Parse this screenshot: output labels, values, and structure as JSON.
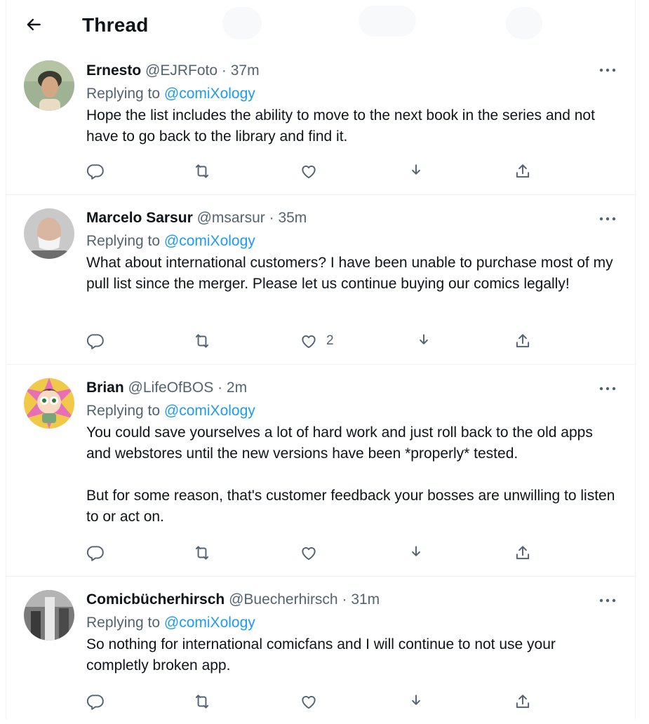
{
  "header": {
    "title": "Thread"
  },
  "tweets": [
    {
      "name": "Ernesto",
      "handle": "@EJRFoto",
      "sep": "·",
      "time": "37m",
      "replying_prefix": "Replying to",
      "replying_to": "@comiXology",
      "text": "Hope the list includes the ability to move to the next book in the series and not have to go back to the library and find it.",
      "like_count": ""
    },
    {
      "name": "Marcelo Sarsur",
      "handle": "@msarsur",
      "sep": "·",
      "time": "35m",
      "replying_prefix": "Replying to",
      "replying_to": "@comiXology",
      "text": "What about international customers? I have been unable to purchase most of my pull list since the merger. Please let us continue buying our comics legally!",
      "like_count": "2"
    },
    {
      "name": "Brian",
      "handle": "@LifeOfBOS",
      "sep": "·",
      "time": "2m",
      "replying_prefix": "Replying to",
      "replying_to": "@comiXology",
      "text": "You could save yourselves a lot of hard work and just roll back to the old apps and webstores until the new versions have been *properly* tested.\n\nBut for some reason, that's customer feedback your bosses are unwilling to listen to or act on.",
      "like_count": ""
    },
    {
      "name": "Comicbücherhirsch",
      "handle": "@Buecherhirsch",
      "sep": "·",
      "time": "31m",
      "replying_prefix": "Replying to",
      "replying_to": "@comiXology",
      "text": "So nothing for international comicfans and I will continue to not use your completly broken app.",
      "like_count": ""
    }
  ],
  "icons": {
    "back": "arrow-left-icon",
    "more": "more-horizontal-icon",
    "reply": "reply-bubble-icon",
    "retweet": "retweet-icon",
    "like": "heart-icon",
    "download": "download-arrow-icon",
    "share": "share-upload-icon"
  },
  "colors": {
    "text": "#0f1419",
    "secondary": "#536471",
    "accent": "#1d9bf0",
    "divider": "#eff3f4"
  }
}
